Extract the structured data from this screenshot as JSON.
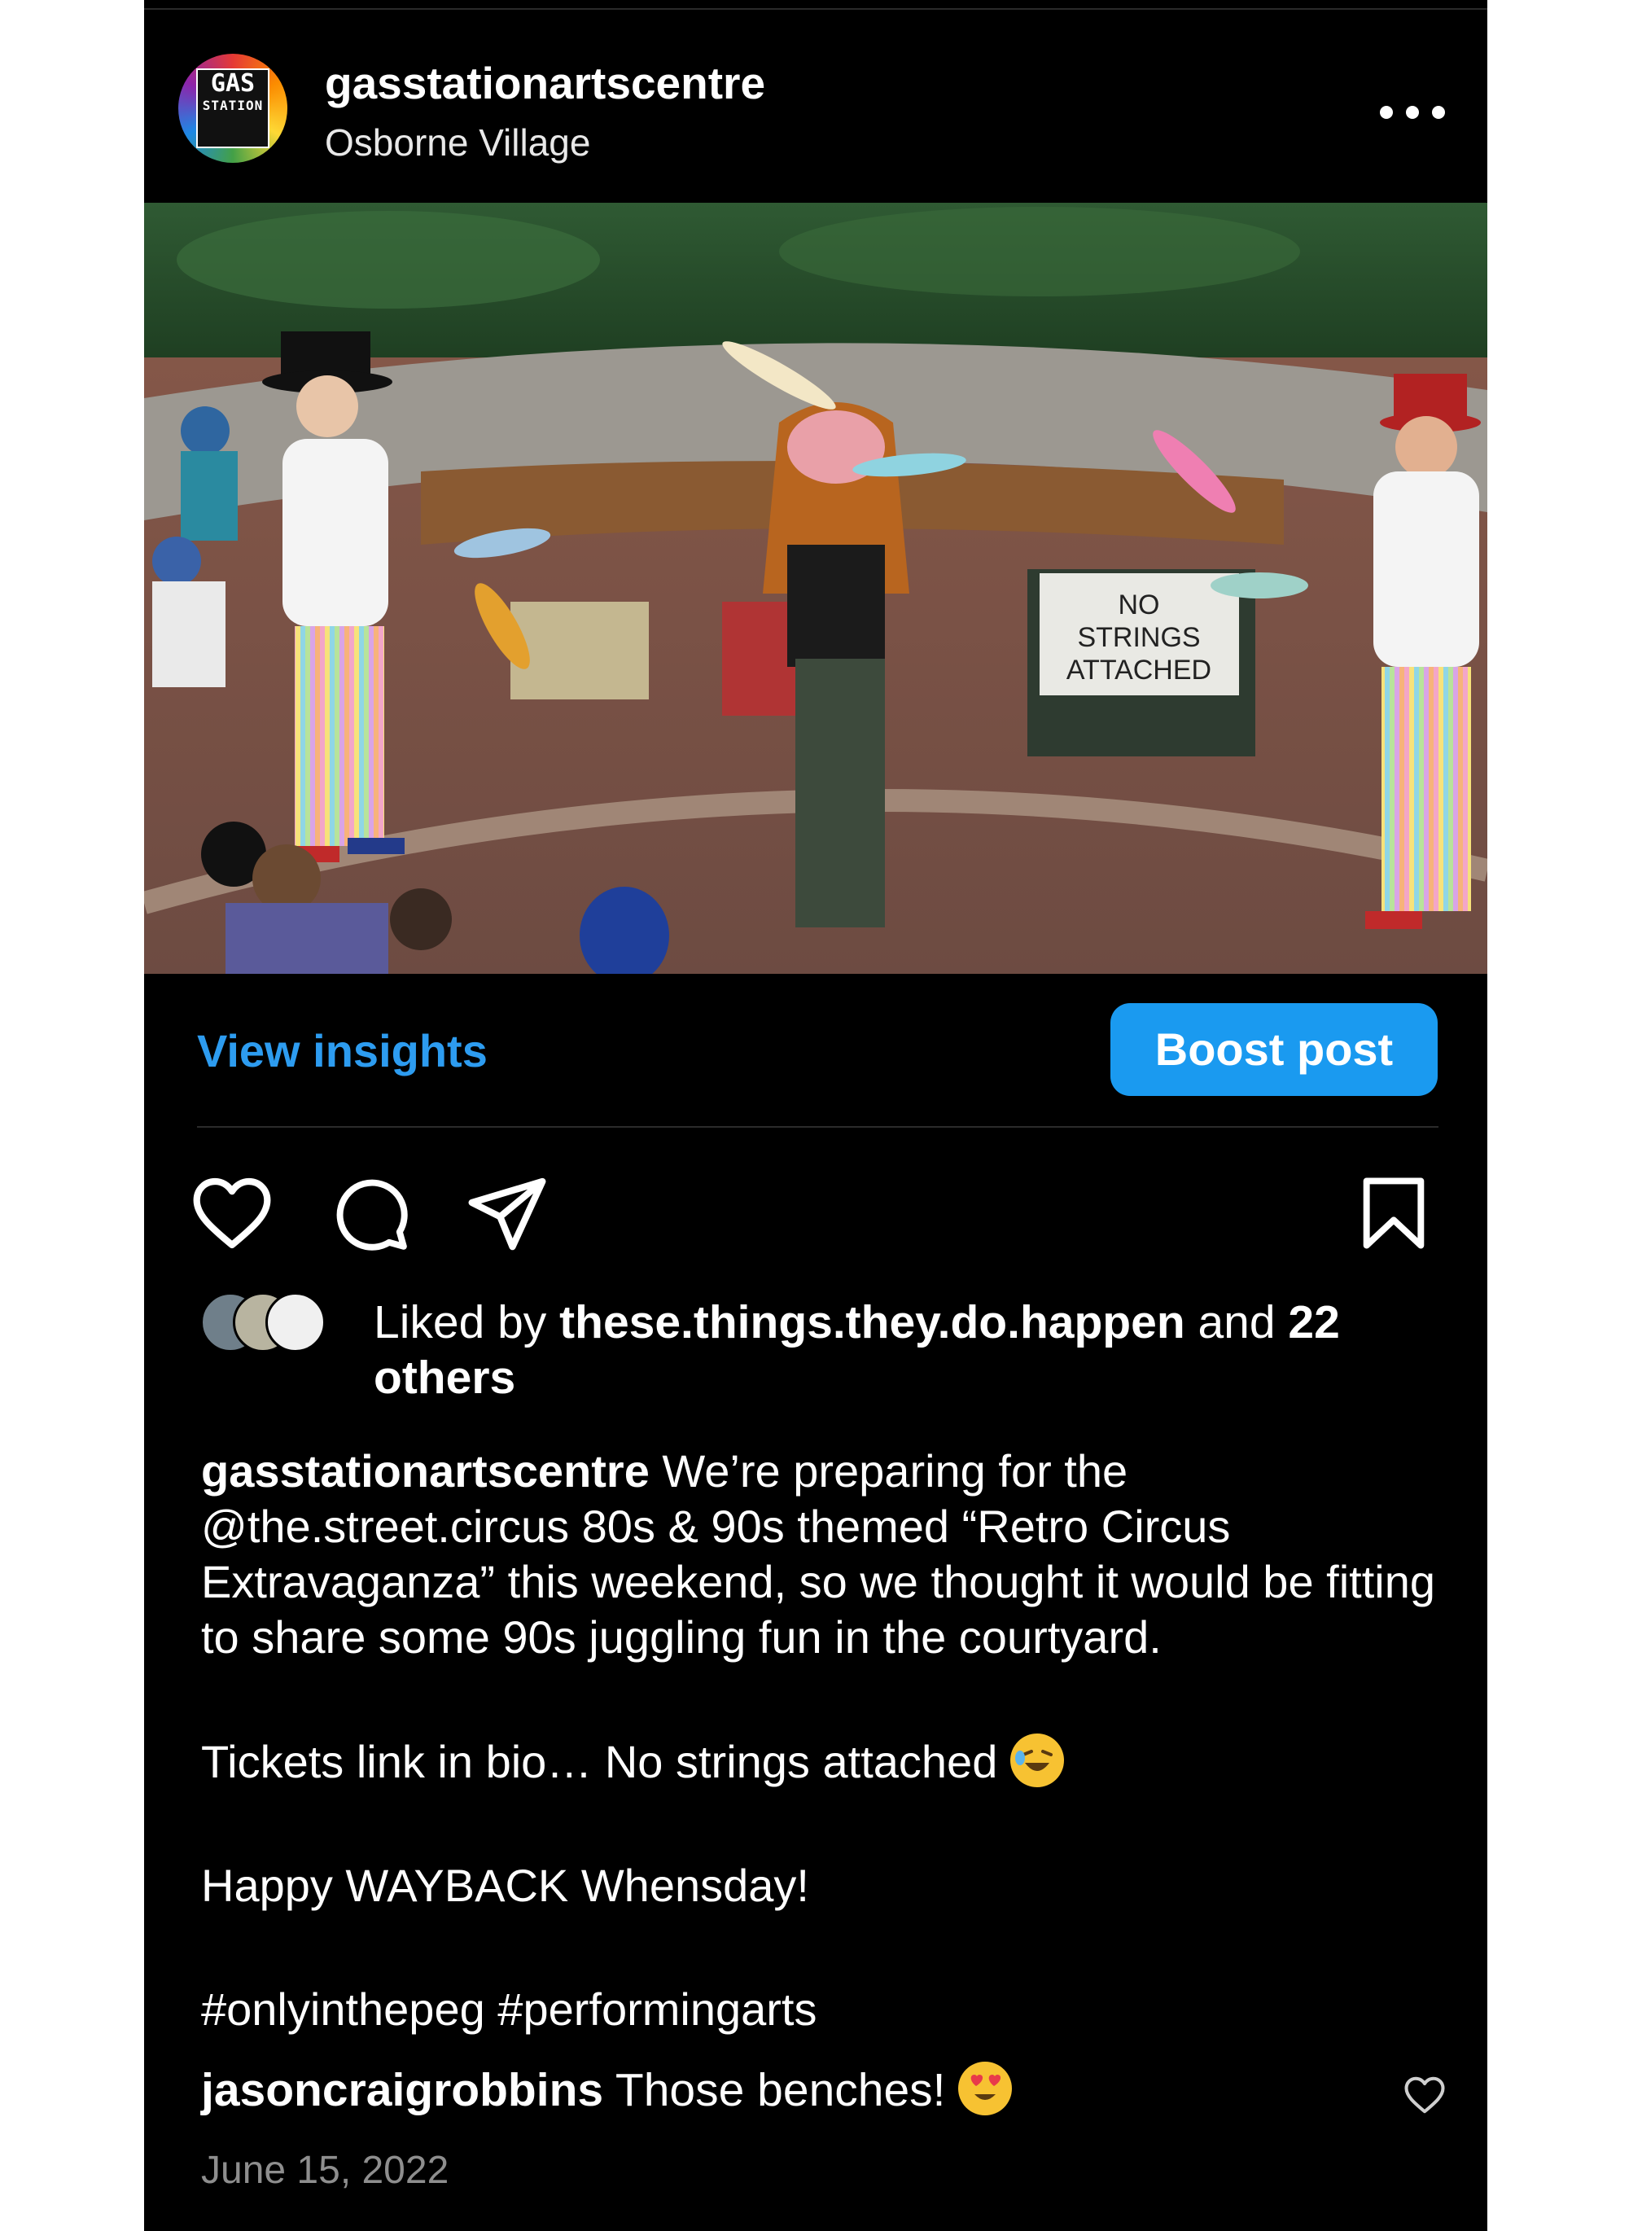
{
  "header": {
    "username": "gasstationartscentre",
    "location": "Osborne Village",
    "avatar_text_top": "GAS",
    "avatar_text_bottom": "STATION"
  },
  "photo": {
    "sign_text_lines": [
      "NO",
      "STRINGS",
      "ATTACHED"
    ]
  },
  "actions": {
    "view_insights": "View insights",
    "boost_post": "Boost post"
  },
  "likes": {
    "prefix": "Liked by ",
    "user": "these.things.they.do.happen",
    "middle": " and ",
    "count": "22",
    "suffix": "others"
  },
  "caption": {
    "username": "gasstationartscentre",
    "paragraph1": " We’re preparing for the @the.street.circus 80s & 90s themed “Retro Circus Extravaganza” this weekend, so we thought it would be fitting to share some 90s juggling fun in the courtyard.",
    "paragraph2": "Tickets link in bio… No strings attached ",
    "paragraph3": "Happy WAYBACK Whensday!",
    "hashtags": "#onlyinthepeg #performingarts"
  },
  "comment": {
    "username": "jasoncraigrobbins",
    "text": " Those benches! "
  },
  "date": "June 15, 2022",
  "colors": {
    "background": "#000000",
    "accent_link": "#2d9cf0",
    "boost_button": "#1a9af0",
    "date_gray": "#8e8e8e"
  },
  "icons": [
    "more-icon",
    "heart-icon",
    "comment-icon",
    "share-icon",
    "save-icon",
    "comment-like-icon"
  ]
}
